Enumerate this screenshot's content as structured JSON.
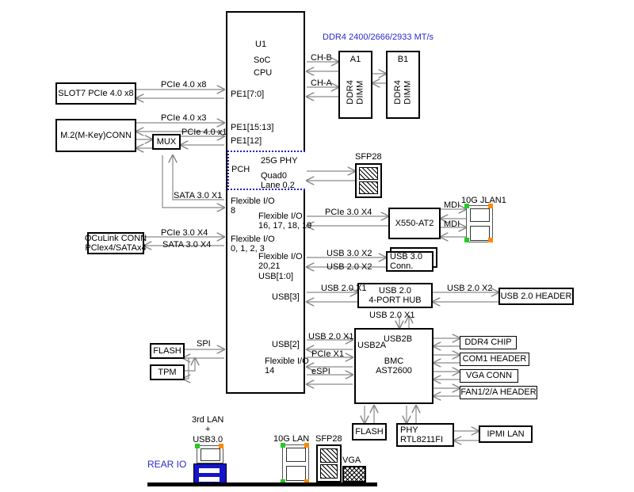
{
  "diagram": {
    "title_memory": "DDR4 2400/2666/2933 MT/s",
    "rear_io_label": "REAR IO"
  },
  "cpu": {
    "u1": "U1",
    "soc": "SoC",
    "cpu": "CPU",
    "ports": {
      "pe1_7_0": "PE1[7:0]",
      "pe1_15_13": "PE1[15:13]",
      "pe1_12": "PE1[12]",
      "pch": "PCH",
      "phy_title": "25G PHY",
      "phy_quad": "Quad0\nLane 0,2",
      "fio8": "Flexible I/O\n8",
      "fio16": "Flexible I/O\n16, 17, 18, 19",
      "fio0": "Flexible I/O\n0, 1, 2, 3",
      "fio20": "Flexible I/O\n20,21\nUSB[1:0]",
      "usb3": "USB[3]",
      "usb2": "USB[2]",
      "fio14": "Flexible I/O\n14"
    }
  },
  "blocks": {
    "slot7": "SLOT7 PCIe 4.0 x8",
    "m2": "M.2(M-Key)CONN",
    "mux": "MUX",
    "oculink": "OCuLink CONN\nPClex4/SATAx4",
    "dimm_a1": "A1",
    "dimm_b1": "B1",
    "dimm_label": "DDR4 DIMM",
    "sfp28": "SFP28",
    "x550": "X550-AT2",
    "jlan": "10G JLAN1",
    "usb3conn": "USB 3.0\nConn.",
    "usbhub": "USB 2.0\n4-PORT HUB",
    "usb2header": "USB 2.0 HEADER",
    "flash": "FLASH",
    "tpm": "TPM",
    "bmc": "BMC\nAST2600",
    "bmc_usb2a": "USB2A",
    "bmc_usb2b": "USB2B",
    "ddr4chip": "DDR4 CHIP",
    "com1": "COM1 HEADER",
    "vgaconn": "VGA CONN",
    "fan": "FAN1/2/A HEADER",
    "bmc_flash": "FLASH",
    "phy": "PHY\nRTL8211FI",
    "ipmi": "IPMI LAN"
  },
  "rear": {
    "third_lan": "3rd LAN\n+\nUSB3.0",
    "lan10g": "10G LAN",
    "sfp28": "SFP28",
    "vga": "VGA"
  },
  "links": {
    "pcie40x8": "PCIe 4.0 x8",
    "pcie40x3": "PCIe 4.0 x3",
    "pcie40x1": "PCIe 4.0 x1",
    "sata30x1": "SATA 3.0 X1",
    "pcie30x4_a": "PCIe 3.0 X4",
    "sata30x4": "SATA 3.0 X4",
    "pcie30x4_b": "PCIe 3.0 X4",
    "usb30x2": "USB 3.0 X2",
    "usb20x2_a": "USB 2.0 X2",
    "usb20x1_a": "USB 2.0 X1",
    "usb20x2_b": "USB 2.0 X2",
    "usb20x1_b": "USB 2.0 X1",
    "usb20x1_c": "USB 2.0 X1",
    "pciex1": "PCIe X1",
    "espi": "eSPI",
    "spi": "SPI",
    "chb": "CH-B",
    "cha": "CH-A",
    "mdi_a": "MDI",
    "mdi_b": "MDI"
  },
  "colors": {
    "wire": "#8a8a8a",
    "accent_blue": "#2a2ad0",
    "led_green": "#22cc22",
    "led_orange": "#ff8800",
    "usb_blue": "#1414c8"
  }
}
